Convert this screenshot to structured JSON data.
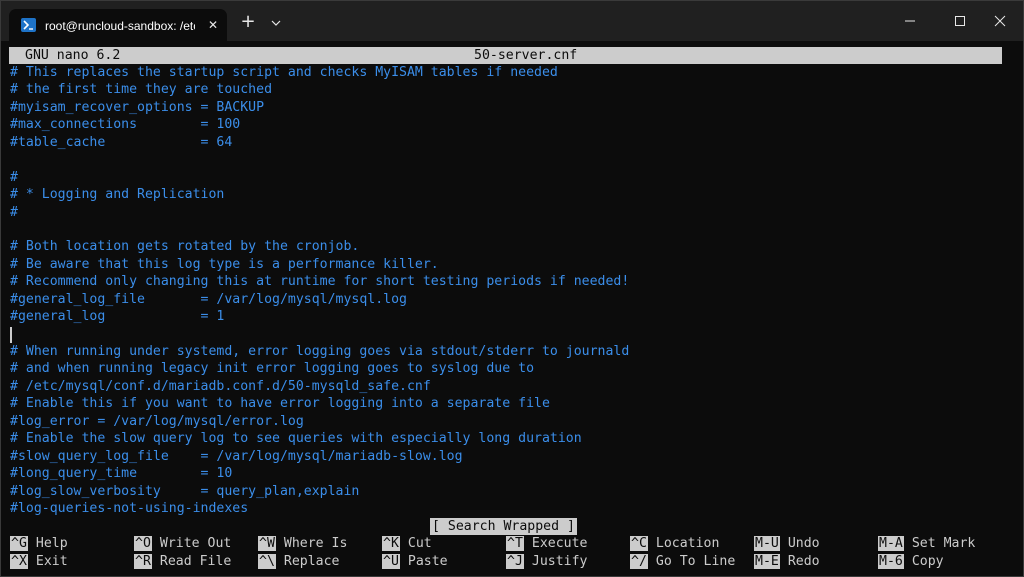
{
  "window": {
    "tab_title": "root@runcloud-sandbox: /etc/",
    "tab_close_glyph": "✕",
    "new_tab_glyph": "+",
    "icons": {
      "tab": "powershell-icon",
      "dropdown": "chevron-down-icon",
      "minimize": "minimize-icon",
      "maximize": "maximize-icon",
      "close": "close-icon"
    }
  },
  "nano": {
    "version": "GNU nano 6.2",
    "filename": "50-server.cnf",
    "status_message": "[ Search Wrapped ]",
    "lines": [
      "# This replaces the startup script and checks MyISAM tables if needed",
      "# the first time they are touched",
      "#myisam_recover_options = BACKUP",
      "#max_connections        = 100",
      "#table_cache            = 64",
      "",
      "#",
      "# * Logging and Replication",
      "#",
      "",
      "# Both location gets rotated by the cronjob.",
      "# Be aware that this log type is a performance killer.",
      "# Recommend only changing this at runtime for short testing periods if needed!",
      "#general_log_file       = /var/log/mysql/mysql.log",
      "#general_log            = 1",
      "",
      "# When running under systemd, error logging goes via stdout/stderr to journald",
      "# and when running legacy init error logging goes to syslog due to",
      "# /etc/mysql/conf.d/mariadb.conf.d/50-mysqld_safe.cnf",
      "# Enable this if you want to have error logging into a separate file",
      "#log_error = /var/log/mysql/error.log",
      "# Enable the slow query log to see queries with especially long duration",
      "#slow_query_log_file    = /var/log/mysql/mariadb-slow.log",
      "#long_query_time        = 10",
      "#log_slow_verbosity     = query_plan,explain",
      "#log-queries-not-using-indexes"
    ],
    "shortcuts_row1": [
      {
        "key": "^G",
        "label": "Help"
      },
      {
        "key": "^O",
        "label": "Write Out"
      },
      {
        "key": "^W",
        "label": "Where Is"
      },
      {
        "key": "^K",
        "label": "Cut"
      },
      {
        "key": "^T",
        "label": "Execute"
      },
      {
        "key": "^C",
        "label": "Location"
      },
      {
        "key": "M-U",
        "label": "Undo"
      },
      {
        "key": "M-A",
        "label": "Set Mark"
      }
    ],
    "shortcuts_row2": [
      {
        "key": "^X",
        "label": "Exit"
      },
      {
        "key": "^R",
        "label": "Read File"
      },
      {
        "key": "^\\",
        "label": "Replace"
      },
      {
        "key": "^U",
        "label": "Paste"
      },
      {
        "key": "^J",
        "label": "Justify"
      },
      {
        "key": "^/",
        "label": "Go To Line"
      },
      {
        "key": "M-E",
        "label": "Redo"
      },
      {
        "key": "M-6",
        "label": "Copy"
      }
    ]
  },
  "colors": {
    "background": "#0c0c0c",
    "text_blue": "#3b8eea",
    "text_light": "#cccccc",
    "titlebar": "#202020",
    "accent": "#1e73c8"
  }
}
